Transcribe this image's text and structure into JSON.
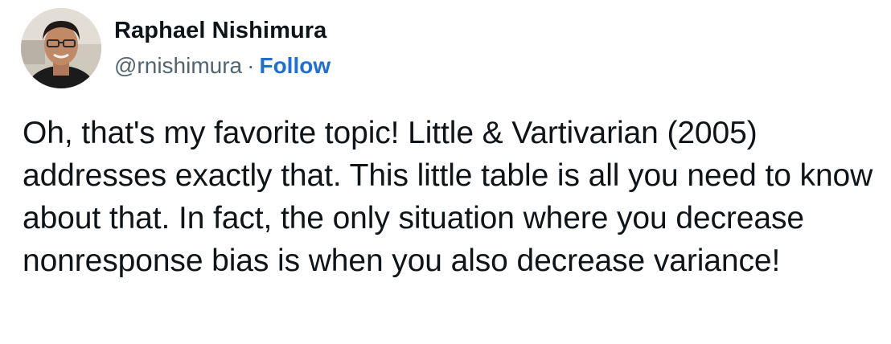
{
  "author": {
    "display_name": "Raphael Nishimura",
    "handle": "@rnishimura",
    "separator": "·",
    "follow_label": "Follow"
  },
  "tweet": {
    "text": "Oh, that's my favorite topic! Little & Vartivarian (2005) addresses exactly that. This little table is all you need to know about that. In fact, the only situation where you decrease nonresponse bias is when you also decrease variance!"
  },
  "colors": {
    "text": "#0f1419",
    "muted": "#536471",
    "link": "#1d6fd6",
    "background": "#ffffff"
  }
}
